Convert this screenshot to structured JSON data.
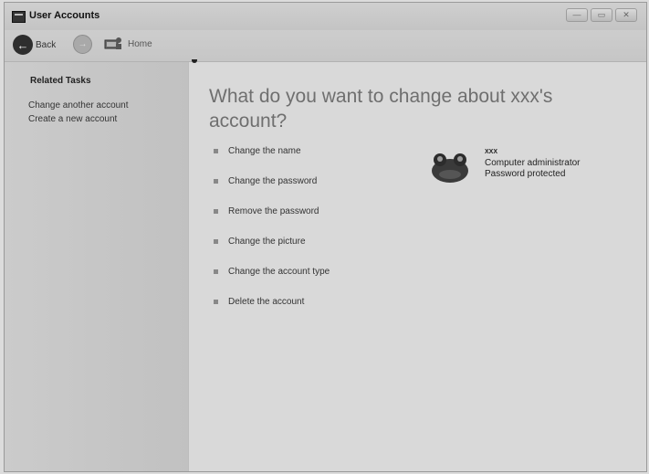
{
  "window": {
    "title": "User Accounts",
    "controls": [
      "minimize",
      "maximize",
      "close"
    ]
  },
  "toolbar": {
    "back_label": "Back",
    "forward_label": "",
    "home_label": "Home"
  },
  "sidebar": {
    "heading": "Related Tasks",
    "links": [
      {
        "label": "Change another account"
      },
      {
        "label": "Create a new account"
      }
    ]
  },
  "main": {
    "heading": "What do you want to change about xxx's account?",
    "tasks": [
      {
        "label": "Change the name"
      },
      {
        "label": "Change the password"
      },
      {
        "label": "Remove the password"
      },
      {
        "label": "Change the picture"
      },
      {
        "label": "Change the account type"
      },
      {
        "label": "Delete the account"
      }
    ]
  },
  "account": {
    "name": "XXX",
    "role": "Computer administrator",
    "status": "Password protected"
  },
  "colors": {
    "window_bg": "#d3d3d3",
    "heading_text": "#6f6f6f",
    "sidebar_bg": "#c6c6c6"
  }
}
